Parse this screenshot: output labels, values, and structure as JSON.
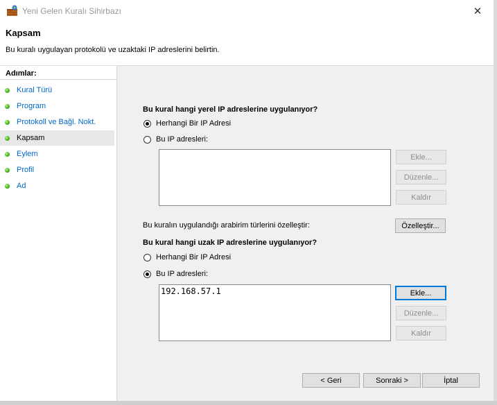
{
  "window": {
    "title": "Yeni Gelen Kuralı Sihirbazı",
    "close_glyph": "✕"
  },
  "header": {
    "title": "Kapsam",
    "description": "Bu kuralı uygulayan protokolü ve uzaktaki IP adreslerini belirtin."
  },
  "sidebar": {
    "heading": "Adımlar:",
    "steps": [
      {
        "label": "Kural Türü"
      },
      {
        "label": "Program"
      },
      {
        "label": "Protokoll ve Bağl. Nokt."
      },
      {
        "label": "Kapsam"
      },
      {
        "label": "Eylem"
      },
      {
        "label": "Profil"
      },
      {
        "label": "Ad"
      }
    ],
    "active_index": 3
  },
  "local": {
    "question": "Bu kural hangi yerel IP adreslerine uygulanıyor?",
    "option_any": "Herhangi Bir IP Adresi",
    "option_these": "Bu IP adresleri:",
    "selected": "any",
    "list": [],
    "add": "Ekle...",
    "edit": "Düzenle...",
    "remove": "Kaldır"
  },
  "interface": {
    "text": "Bu kuralın uygulandığı arabirim türlerini özelleştir:",
    "customize": "Özelleştir..."
  },
  "remote": {
    "question": "Bu kural hangi uzak IP adreslerine uygulanıyor?",
    "option_any": "Herhangi Bir IP Adresi",
    "option_these": "Bu IP adresleri:",
    "selected": "these",
    "list": [
      "192.168.57.1"
    ],
    "add": "Ekle...",
    "edit": "Düzenle...",
    "remove": "Kaldır"
  },
  "footer": {
    "back": "< Geri",
    "next": "Sonraki >",
    "cancel": "İptal"
  },
  "colors": {
    "link": "#0066cc",
    "step_dot": "#3fae1b",
    "focus": "#0078d7"
  }
}
